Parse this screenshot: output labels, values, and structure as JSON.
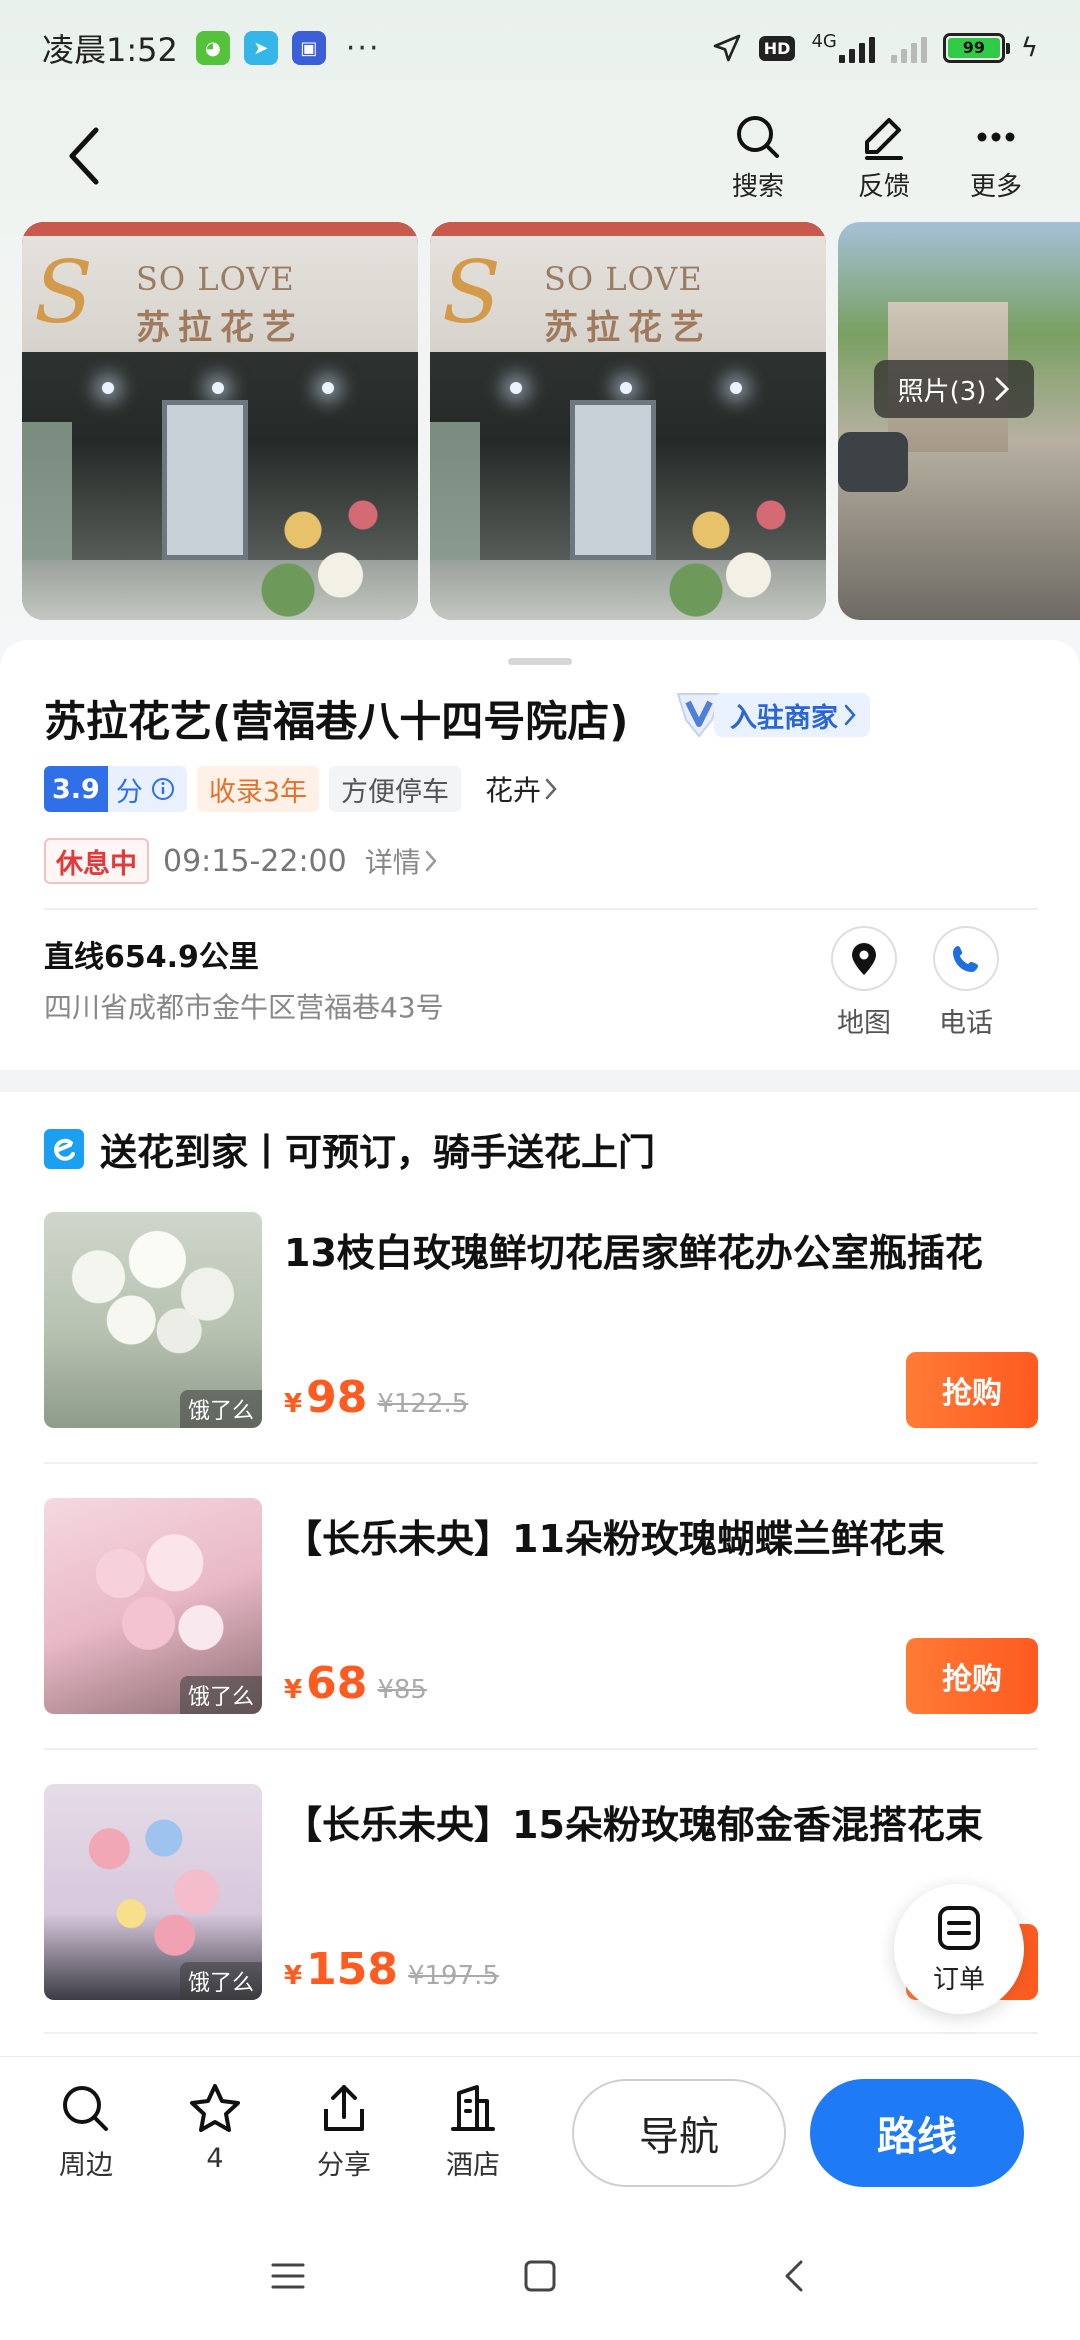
{
  "status": {
    "time": "凌晨1:52",
    "dots": "···",
    "network": "4G",
    "hd": "HD",
    "battery": "99",
    "icons": [
      "wechat-icon",
      "telegram-icon",
      "app-icon",
      "location-arrow-icon",
      "bolt-icon"
    ]
  },
  "header": {
    "search_label": "搜索",
    "feedback_label": "反馈",
    "more_label": "更多"
  },
  "photos": {
    "brand_en": "SO LOVE",
    "brand_cn": "苏拉花艺",
    "count_label": "照片(3)"
  },
  "shop": {
    "title": "苏拉花艺(营福巷八十四号院店)",
    "merchant_label": "入驻商家",
    "score": "3.9",
    "score_unit": "分",
    "tags": [
      "收录3年",
      "方便停车"
    ],
    "category": "花卉",
    "status": "休息中",
    "hours": "09:15-22:00",
    "detail": "详情",
    "distance": "直线654.9公里",
    "address": "四川省成都市金牛区营福巷43号",
    "map_label": "地图",
    "phone_label": "电话"
  },
  "section": {
    "title": "送花到家丨可预订，骑手送花上门",
    "watermark": "饿了么",
    "currency": "¥",
    "buy_label": "抢购",
    "products": [
      {
        "name": "13枝白玫瑰鲜切花居家鲜花办公室瓶插花",
        "price": "98",
        "old_price": "¥122.5"
      },
      {
        "name": "【长乐未央】11朵粉玫瑰蝴蝶兰鲜花束",
        "price": "68",
        "old_price": "¥85"
      },
      {
        "name": "【长乐未央】15朵粉玫瑰郁金香混搭花束",
        "price": "158",
        "old_price": "¥197.5"
      }
    ]
  },
  "fab": {
    "order_label": "订单"
  },
  "bottom": {
    "nearby_label": "周边",
    "star_count": "4",
    "share_label": "分享",
    "hotel_label": "酒店",
    "navigate_label": "导航",
    "route_label": "路线"
  },
  "colors": {
    "accent": "#1f7bf5",
    "price": "#ff5a1f",
    "closed": "#e03a3a",
    "score": "#2f6fe8"
  }
}
